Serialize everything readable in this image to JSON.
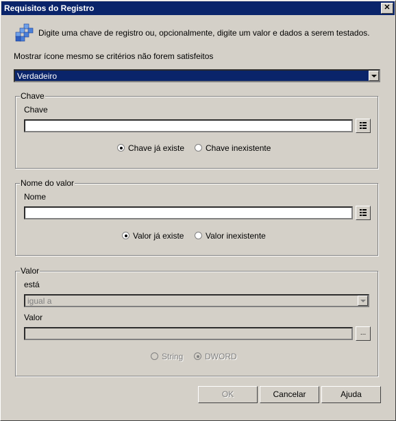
{
  "window": {
    "title": "Requisitos do Registro",
    "close_glyph": "✕"
  },
  "intro_icon": "registry-cubes-icon",
  "intro_text": "Digite uma chave de registro ou, opcionalmente, digite um valor e dados a serem testados.",
  "show_icon_label": "Mostrar ícone mesmo se critérios não forem satisfeitos",
  "show_icon_select": {
    "value": "Verdadeiro"
  },
  "key_group": {
    "legend": "Chave",
    "field_label": "Chave",
    "field_value": "",
    "browse_icon": "browse-list-icon",
    "radio_exists": "Chave já existe",
    "radio_not_exists": "Chave inexistente",
    "selected": "exists"
  },
  "value_name_group": {
    "legend": "Nome do valor",
    "field_label": "Nome",
    "field_value": "",
    "browse_icon": "browse-list-icon",
    "radio_exists": "Valor já existe",
    "radio_not_exists": "Valor inexistente",
    "selected": "exists"
  },
  "value_group": {
    "legend": "Valor",
    "is_label": "está",
    "operator_value": "igual a",
    "value_label": "Valor",
    "value_value": "",
    "browse_label": "...",
    "radio_string": "String",
    "radio_dword": "DWORD",
    "selected": "dword"
  },
  "buttons": {
    "ok": "OK",
    "cancel": "Cancelar",
    "help": "Ajuda"
  }
}
